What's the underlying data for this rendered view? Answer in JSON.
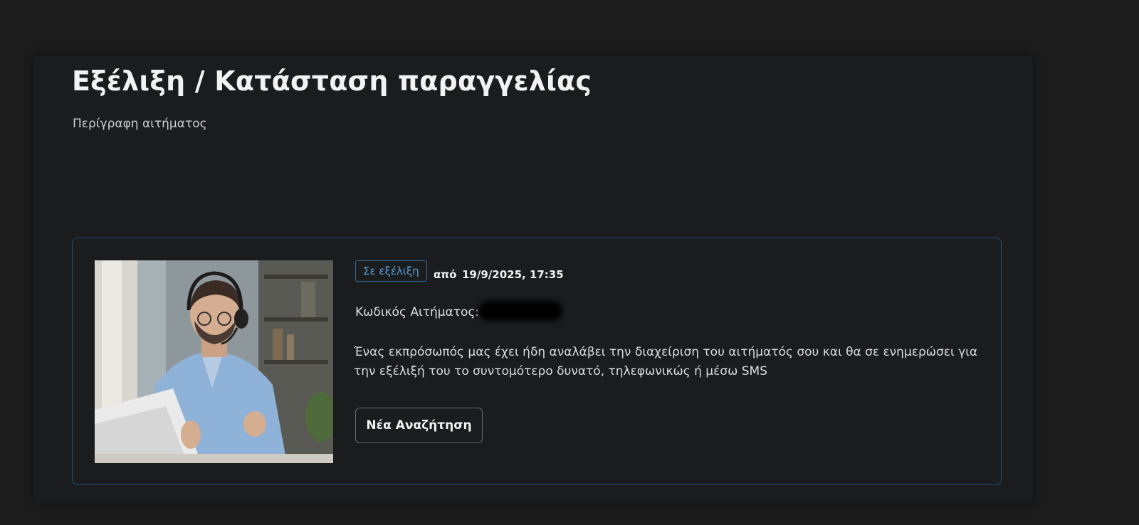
{
  "header": {
    "title": "Εξέλιξη / Κατάσταση παραγγελίας",
    "subtitle": "Περίγραφη αιτήματος"
  },
  "request": {
    "status_badge": "Σε εξέλιξη",
    "from_label": "από",
    "datetime": "19/9/2025, 17:35",
    "code_label": "Κωδικός Αιτήματος:",
    "code_value": "",
    "message": "Ένας εκπρόσωπός μας έχει ήδη αναλάβει την διαχείριση του αιτήματός σου και θα σε ενημερώσει για την εξέλιξή του το συντομότερο δυνατό, τηλεφωνικώς ή μέσω SMS",
    "new_search_label": "Νέα Αναζήτηση"
  },
  "colors": {
    "accent": "#2f6aa0",
    "badge_text": "#5a9fd8",
    "card_border": "#1f4f78",
    "background": "#1c1c1d"
  },
  "icons": {
    "photo": "support-agent-photo"
  }
}
